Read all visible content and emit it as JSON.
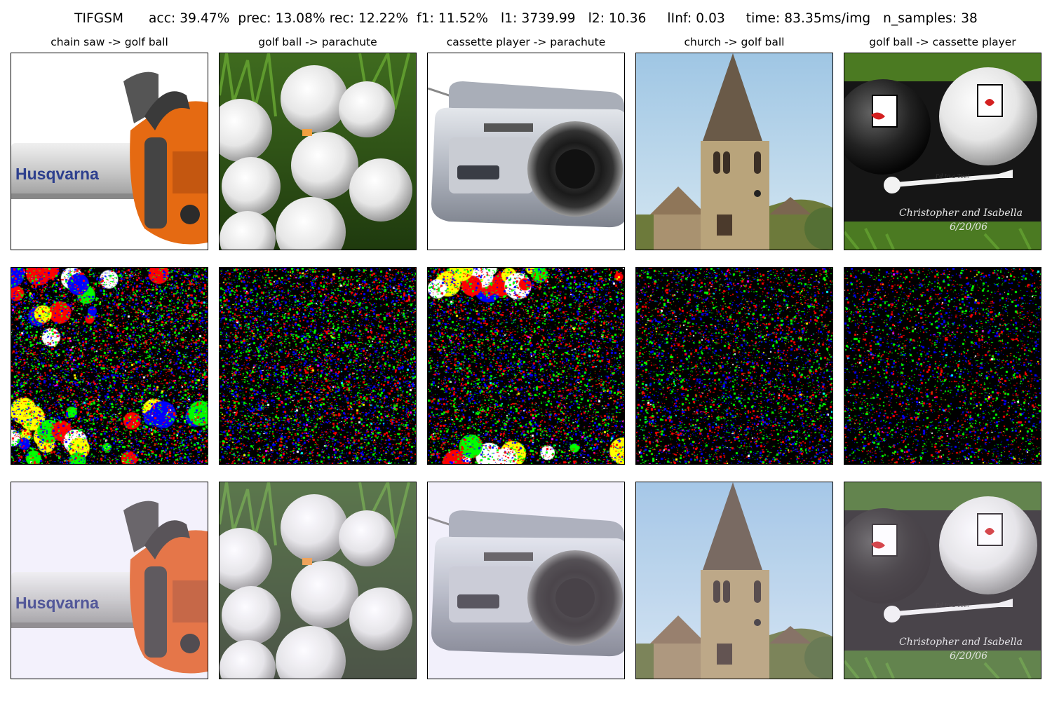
{
  "figure": {
    "suptitle": "TIFGSM      acc: 39.47%  prec: 13.08% rec: 12.22%  f1: 11.52%   l1: 3739.99   l2: 10.36     lInf: 0.03     time: 83.35ms/img   n_samples: 38"
  },
  "columns": [
    {
      "title": "chain saw -> golf ball"
    },
    {
      "title": "golf ball -> parachute"
    },
    {
      "title": "cassette player -> parachute"
    },
    {
      "title": "church -> golf ball"
    },
    {
      "title": "golf ball -> cassette player"
    }
  ],
  "images": {
    "chainsaw": {
      "brand_text": "Husqvarna"
    },
    "golfball_tag": {
      "tee_text": "I'd to a Tee!",
      "names_text": "Christopher and Isabella",
      "date_text": "6/20/06"
    }
  },
  "colors": {
    "perturb_red": "#ff0000",
    "perturb_green": "#00ff00",
    "perturb_blue": "#0000ff",
    "perturb_yellow": "#ffff00",
    "perturb_white": "#ffffff",
    "perturb_magenta": "#ff00ff",
    "perturb_cyan": "#00ffff"
  }
}
